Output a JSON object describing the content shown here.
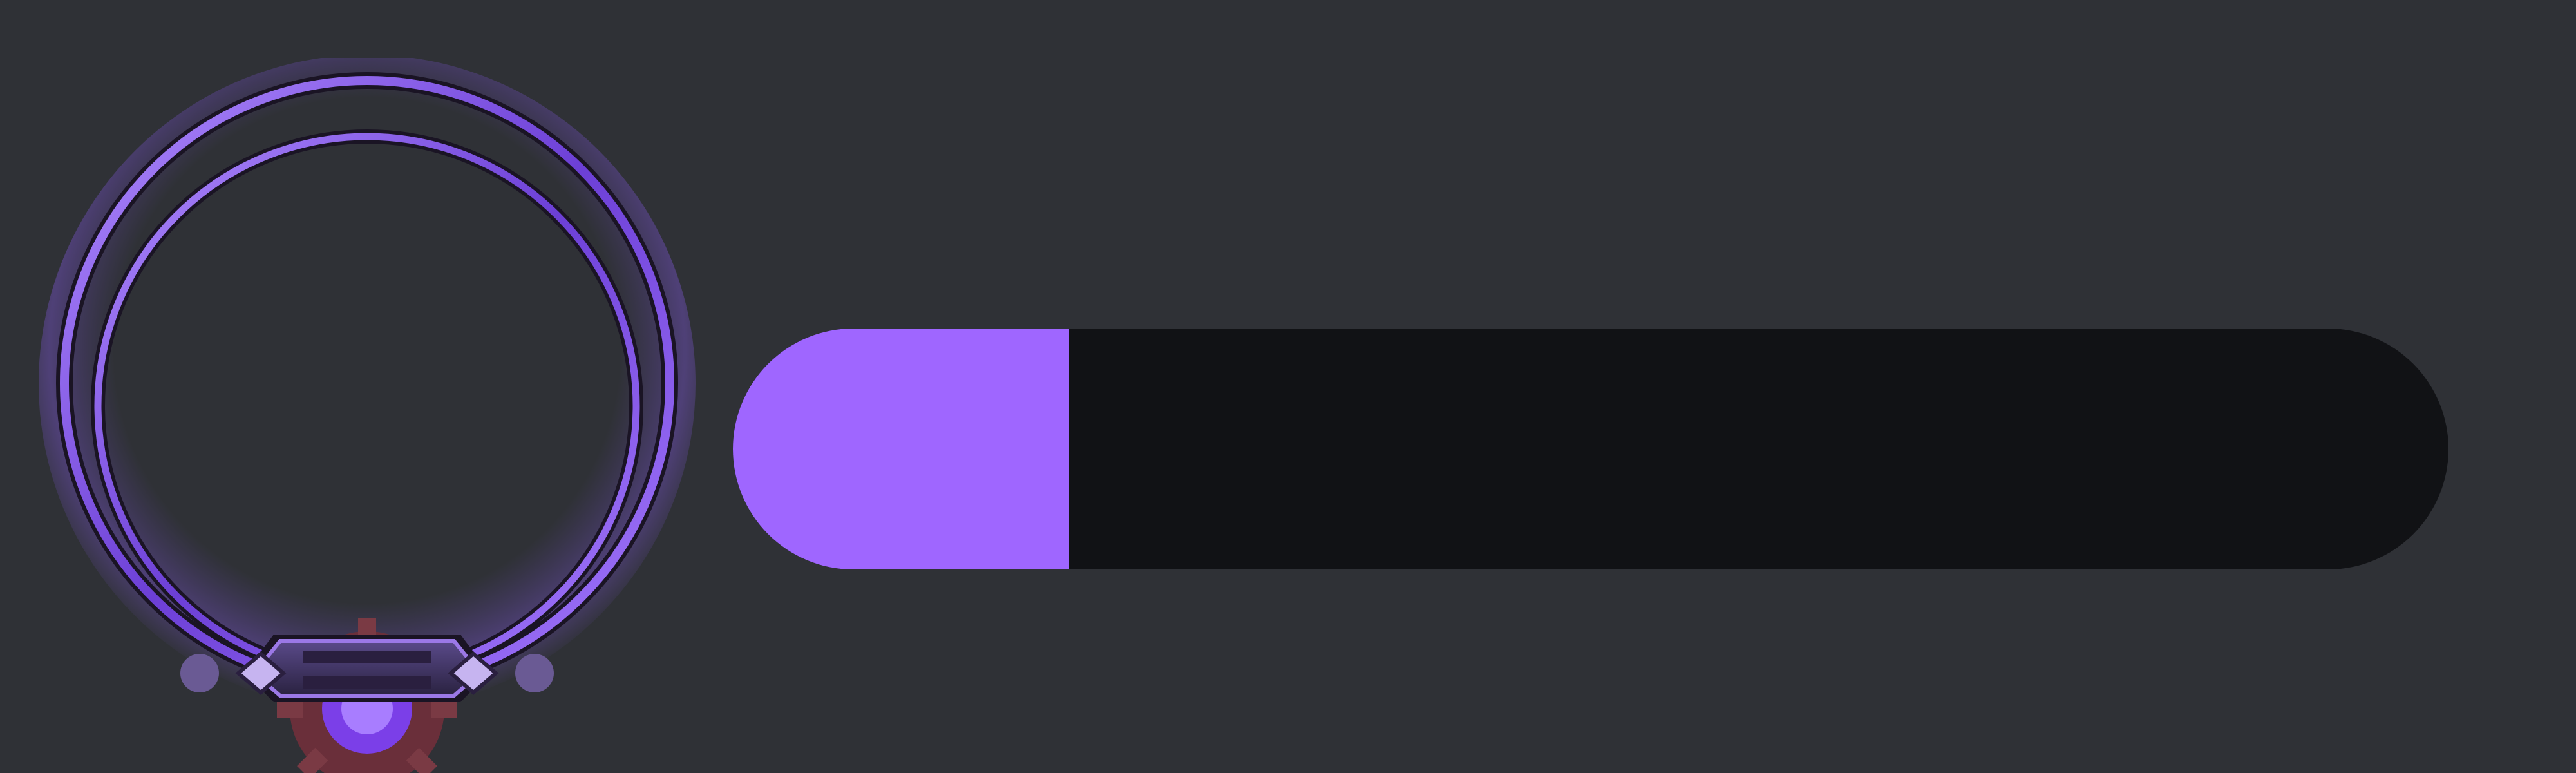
{
  "theme": {
    "background": "#2f3136",
    "track_color": "#111215",
    "fill_color": "#9f66ff",
    "frame_color": "#8a5cf0"
  },
  "avatar": {
    "icon": "avatar-decoration-frame",
    "image": ""
  },
  "progress": {
    "fraction": 0.196
  }
}
